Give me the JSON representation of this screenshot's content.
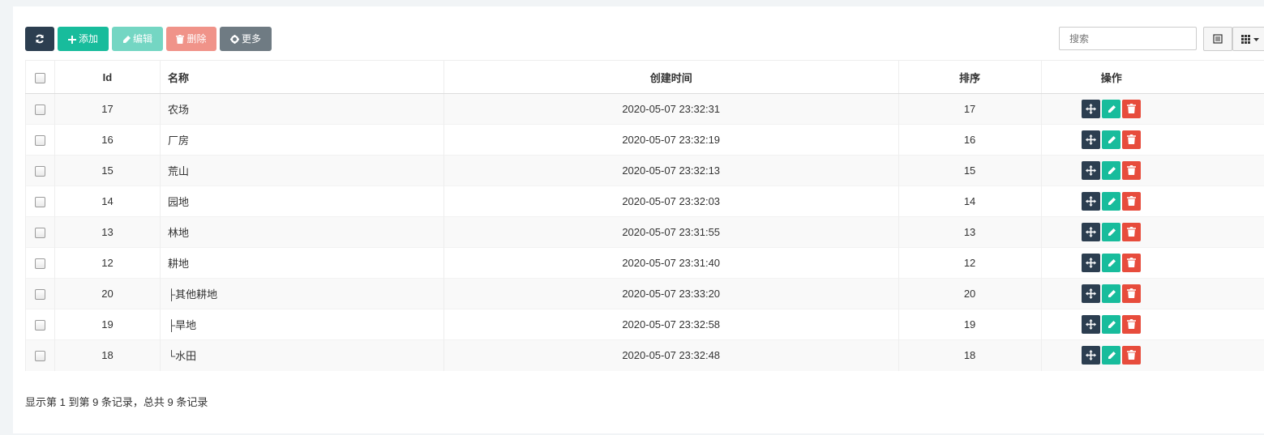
{
  "toolbar": {
    "add_label": "添加",
    "edit_label": "编辑",
    "delete_label": "删除",
    "more_label": "更多"
  },
  "search": {
    "placeholder": "搜索"
  },
  "table": {
    "headers": {
      "id": "Id",
      "name": "名称",
      "created": "创建时间",
      "sort": "排序",
      "actions": "操作"
    },
    "rows": [
      {
        "id": "17",
        "name": "农场",
        "created": "2020-05-07 23:32:31",
        "sort": "17"
      },
      {
        "id": "16",
        "name": "厂房",
        "created": "2020-05-07 23:32:19",
        "sort": "16"
      },
      {
        "id": "15",
        "name": "荒山",
        "created": "2020-05-07 23:32:13",
        "sort": "15"
      },
      {
        "id": "14",
        "name": "园地",
        "created": "2020-05-07 23:32:03",
        "sort": "14"
      },
      {
        "id": "13",
        "name": "林地",
        "created": "2020-05-07 23:31:55",
        "sort": "13"
      },
      {
        "id": "12",
        "name": "耕地",
        "created": "2020-05-07 23:31:40",
        "sort": "12"
      },
      {
        "id": "20",
        "name": "├其他耕地",
        "created": "2020-05-07 23:33:20",
        "sort": "20"
      },
      {
        "id": "19",
        "name": "├旱地",
        "created": "2020-05-07 23:32:58",
        "sort": "19"
      },
      {
        "id": "18",
        "name": "└水田",
        "created": "2020-05-07 23:32:48",
        "sort": "18"
      }
    ]
  },
  "footer": {
    "summary": "显示第 1 到第 9 条记录，总共 9 条记录"
  },
  "colors": {
    "dark": "#2c3e50",
    "success": "#18bc9c",
    "danger": "#e74c3c",
    "muted": "#6f7b83"
  },
  "icons": [
    "refresh-icon",
    "plus-icon",
    "pencil-icon",
    "trash-icon",
    "gear-icon",
    "list-icon",
    "grid-icon",
    "caret-down-icon",
    "move-icon"
  ]
}
